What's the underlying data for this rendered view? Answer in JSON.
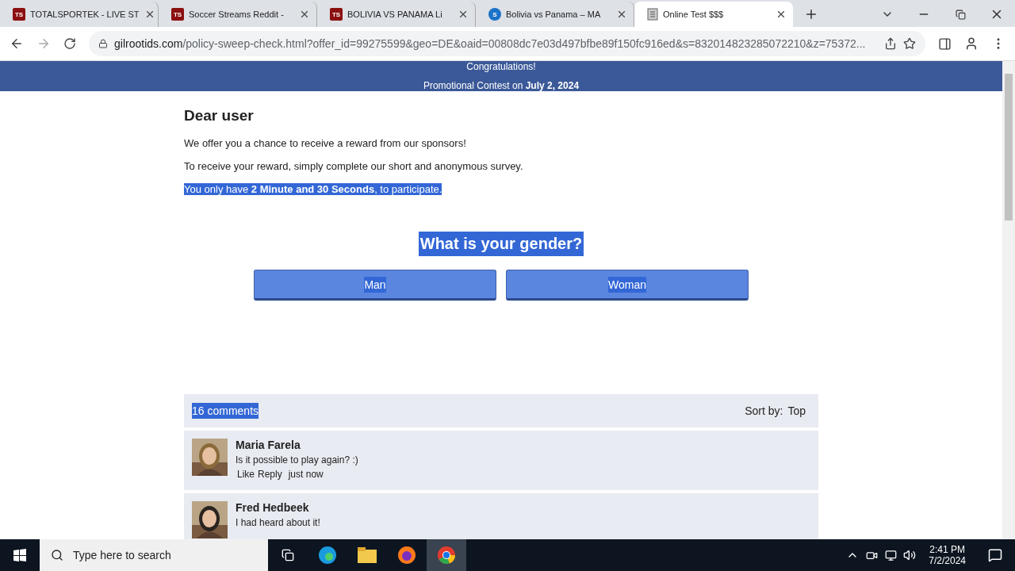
{
  "tabs": [
    {
      "title": "TOTALSPORTEK - LIVE ST",
      "favicon": "TS",
      "kind": "square",
      "selected": false
    },
    {
      "title": "Soccer Streams Reddit -",
      "favicon": "TS",
      "kind": "square",
      "selected": false
    },
    {
      "title": "BOLIVIA VS PANAMA Li",
      "favicon": "TS",
      "kind": "square",
      "selected": false
    },
    {
      "title": "Bolivia vs Panama – MA",
      "favicon": "S",
      "kind": "circle",
      "selected": false
    },
    {
      "title": "Online Test $$$",
      "kind": "document",
      "selected": true
    }
  ],
  "address_bar": {
    "domain": "gilrootids.com",
    "path": "/policy-sweep-check.html?offer_id=99275599&geo=DE&oaid=00808dc7e03d497bfbe89f150fc916ed&s=832014823285072210&z=75372..."
  },
  "banner": {
    "line1": "Congratulations!",
    "line2": "Promotional Contest on **July 2, 2024**"
  },
  "heading": "Dear user",
  "paragraphs": [
    {
      "text": "We offer you a chance to receive a reward from our sponsors!",
      "highlighted": false
    },
    {
      "text": "To receive your reward, simply complete our short and anonymous survey.",
      "highlighted": false
    },
    {
      "text": "You only have **2 Minute and 30 Seconds**, to participate.",
      "highlighted": true
    }
  ],
  "question": {
    "text": "What is your gender?",
    "highlighted": true
  },
  "answers": [
    {
      "label": "Man",
      "highlighted": true
    },
    {
      "label": "Woman",
      "highlighted": true
    }
  ],
  "comments": {
    "count": "16 comments",
    "count_highlighted": true,
    "sort_label": "Sort by:",
    "sort_value": "Top",
    "items": [
      {
        "name": "Maria Farela",
        "text": "Is it possible to play again? :)",
        "like": "Like",
        "reply": "Reply",
        "time": "just now"
      },
      {
        "name": "Fred Hedbeek",
        "text": "I had heard about it!"
      }
    ]
  },
  "taskbar": {
    "search_placeholder": "Type here to search",
    "time": "2:41 PM",
    "date": "7/2/2024"
  }
}
